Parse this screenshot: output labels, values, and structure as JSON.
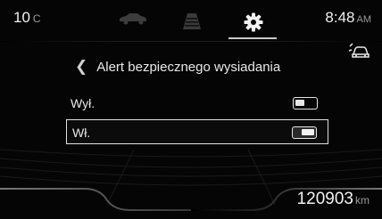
{
  "status_bar": {
    "temperature": "10",
    "temperature_unit": "C",
    "time": "8:48",
    "time_suffix": "AM"
  },
  "tabs": [
    {
      "icon": "car-icon",
      "active": false
    },
    {
      "icon": "road-icon",
      "active": false
    },
    {
      "icon": "gear-icon",
      "active": true
    }
  ],
  "menu": {
    "title": "Alert bezpiecznego wysiadania",
    "options": [
      {
        "label": "Wył.",
        "toggle_on": false,
        "selected": false
      },
      {
        "label": "Wł.",
        "toggle_on": true,
        "selected": true
      }
    ]
  },
  "odometer": {
    "value": "120903",
    "unit": "km"
  },
  "colors": {
    "background": "#050505",
    "text": "#e8e8e8",
    "muted": "#9a9a9a",
    "selection_border": "#e0e0e0"
  }
}
